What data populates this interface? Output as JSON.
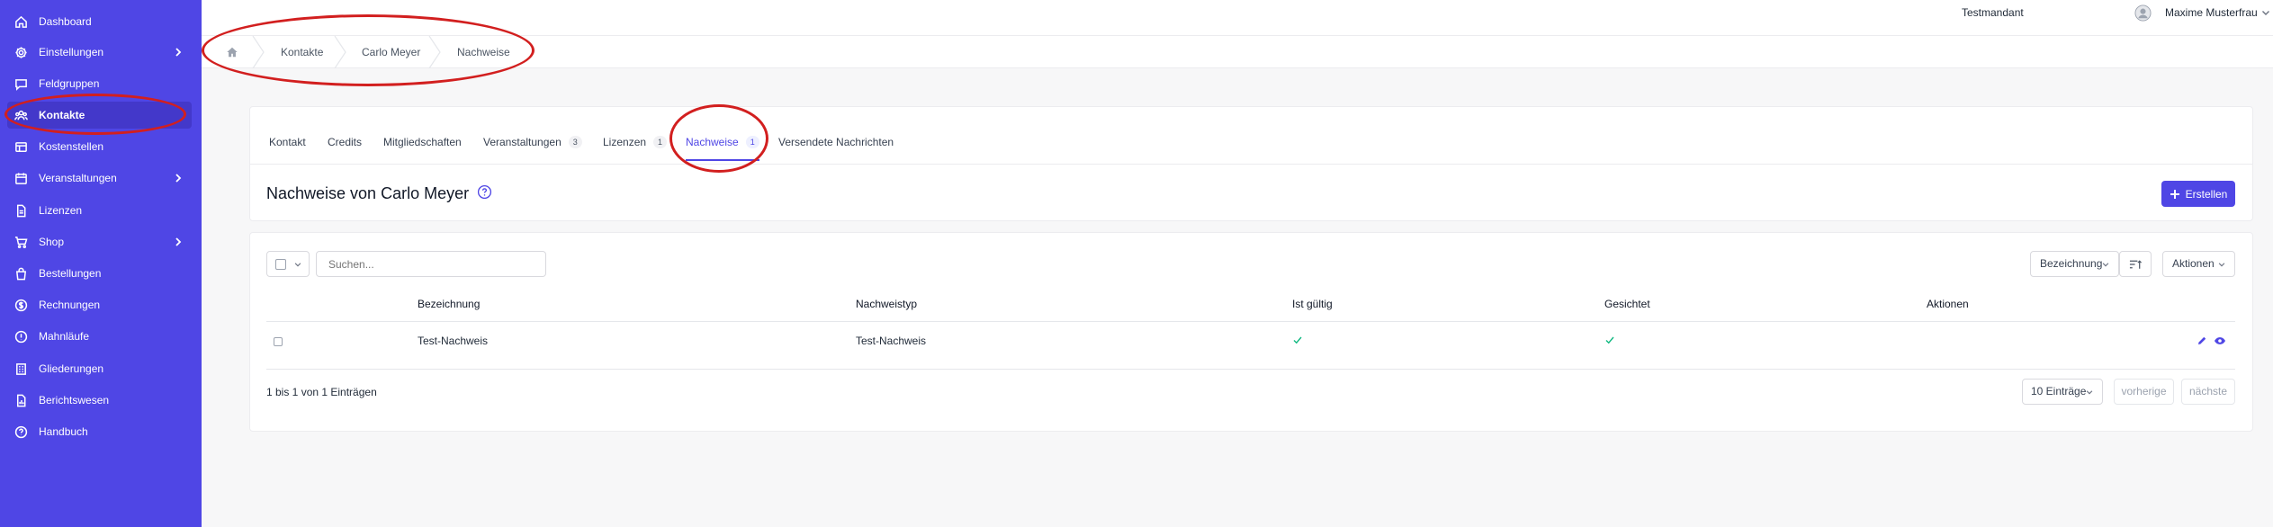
{
  "sidebar": {
    "items": [
      {
        "label": "Dashboard",
        "icon": "home-icon"
      },
      {
        "label": "Einstellungen",
        "icon": "gear-icon",
        "has_children": true
      },
      {
        "label": "Feldgruppen",
        "icon": "chat-icon"
      },
      {
        "label": "Kontakte",
        "icon": "users-icon",
        "active": true
      },
      {
        "label": "Kostenstellen",
        "icon": "table-icon"
      },
      {
        "label": "Veranstaltungen",
        "icon": "calendar-icon",
        "has_children": true
      },
      {
        "label": "Lizenzen",
        "icon": "document-icon"
      },
      {
        "label": "Shop",
        "icon": "cart-icon",
        "has_children": true
      },
      {
        "label": "Bestellungen",
        "icon": "bag-icon"
      },
      {
        "label": "Rechnungen",
        "icon": "dollar-icon"
      },
      {
        "label": "Mahnläufe",
        "icon": "alert-icon"
      },
      {
        "label": "Gliederungen",
        "icon": "building-icon"
      },
      {
        "label": "Berichtswesen",
        "icon": "report-icon"
      },
      {
        "label": "Handbuch",
        "icon": "help-icon"
      }
    ]
  },
  "topbar": {
    "tenant": "Testmandant",
    "user": "Maxime Musterfrau"
  },
  "breadcrumb": {
    "items": [
      "Kontakte",
      "Carlo Meyer",
      "Nachweise"
    ]
  },
  "tabs": [
    {
      "label": "Kontakt"
    },
    {
      "label": "Credits"
    },
    {
      "label": "Mitgliedschaften"
    },
    {
      "label": "Veranstaltungen",
      "count": "3"
    },
    {
      "label": "Lizenzen",
      "count": "1"
    },
    {
      "label": "Nachweise",
      "count": "1",
      "active": true
    },
    {
      "label": "Versendete Nachrichten"
    }
  ],
  "page": {
    "title": "Nachweise von Carlo Meyer",
    "create_label": "Erstellen"
  },
  "table": {
    "search_placeholder": "Suchen...",
    "sort_field": "Bezeichnung",
    "actions_label": "Aktionen",
    "columns": [
      "Bezeichnung",
      "Nachweistyp",
      "Ist gültig",
      "Gesichtet",
      "Aktionen"
    ],
    "rows": [
      {
        "bezeichnung": "Test-Nachweis",
        "nachweistyp": "Test-Nachweis",
        "ist_gueltig": true,
        "gesichtet": true
      }
    ],
    "summary": "1 bis 1 von 1 Einträgen",
    "page_size": "10 Einträge",
    "prev_label": "vorherige",
    "next_label": "nächste"
  },
  "colors": {
    "accent": "#4f46e5",
    "sidebar_active": "#4338ca",
    "check": "#10b981",
    "annotation": "#d21f1f"
  }
}
